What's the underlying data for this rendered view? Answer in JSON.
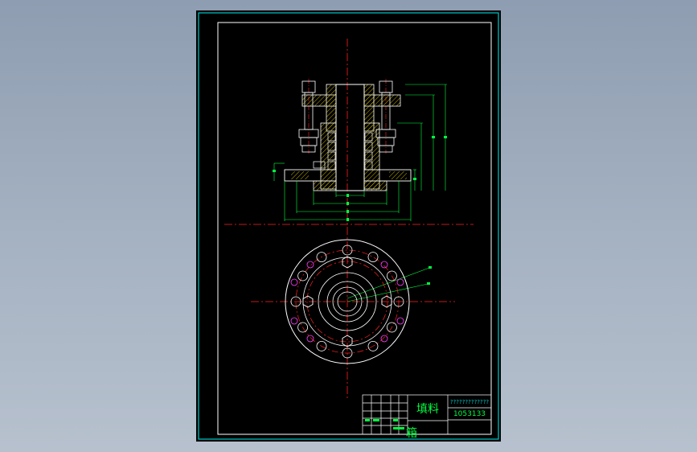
{
  "title_block": {
    "material_label": "填料",
    "material_label_2": "箱",
    "question_marks": "?????????????",
    "drawing_number": "1053133",
    "rows": [
      "",
      "",
      "",
      "",
      ""
    ]
  },
  "colors": {
    "background": "#000000",
    "frame": "#ffffff",
    "border_cyan": "#00c8c8",
    "centerline": "#ff2020",
    "part_outline": "#ffffff",
    "hatch": "#c8b400",
    "dimension": "#00ff40",
    "hole": "#ff40ff"
  },
  "icons": [
    "hex-nut-icon",
    "bolt-hole-icon"
  ]
}
